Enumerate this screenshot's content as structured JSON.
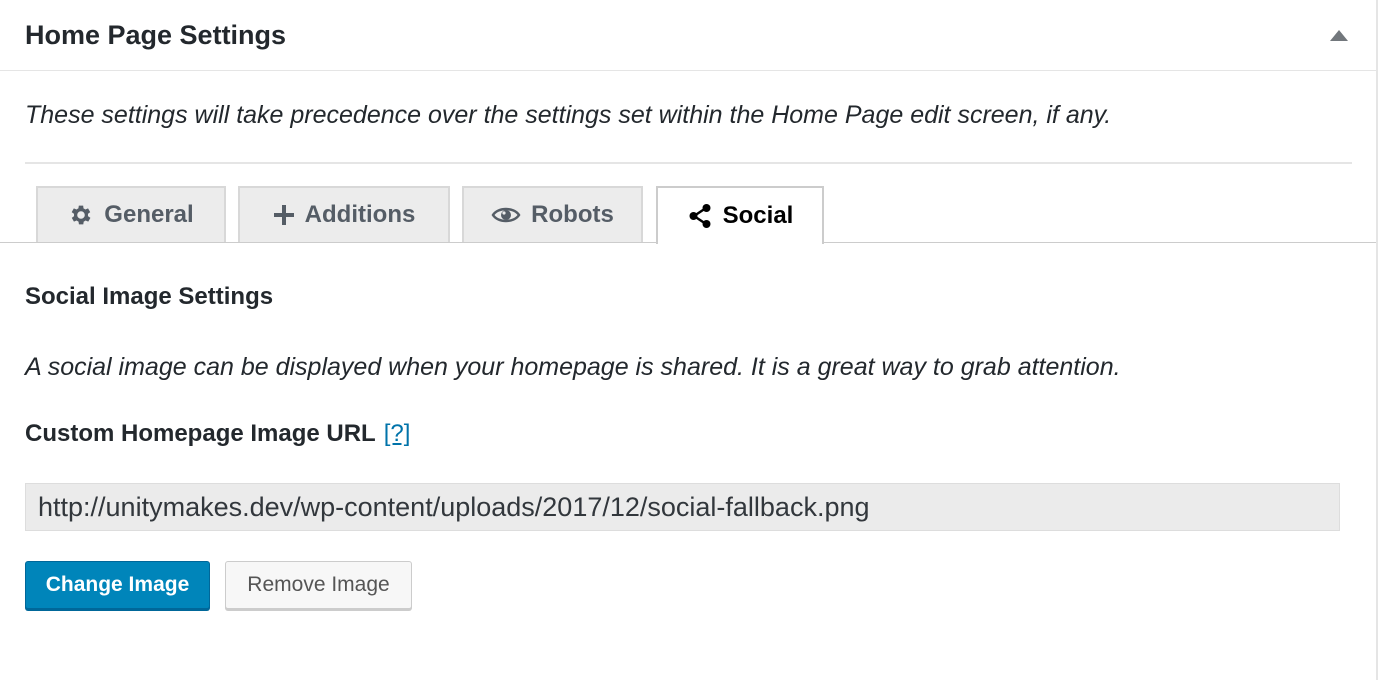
{
  "panel": {
    "title": "Home Page Settings",
    "toggle_icon": "triangle-up-icon",
    "description": "These settings will take precedence over the settings set within the Home Page edit screen, if any."
  },
  "tabs": [
    {
      "label": "General",
      "icon": "gear-icon",
      "active": false
    },
    {
      "label": "Additions",
      "icon": "plus-icon",
      "active": false
    },
    {
      "label": "Robots",
      "icon": "eye-icon",
      "active": false
    },
    {
      "label": "Social",
      "icon": "share-icon",
      "active": true
    }
  ],
  "social": {
    "section_title": "Social Image Settings",
    "section_description": "A social image can be displayed when your homepage is shared. It is a great way to grab attention.",
    "field_label": "Custom Homepage Image URL",
    "help_link": "[?]",
    "image_url": "http://unitymakes.dev/wp-content/uploads/2017/12/social-fallback.png",
    "change_button": "Change Image",
    "remove_button": "Remove Image"
  },
  "colors": {
    "primary_button": "#0085ba",
    "link": "#0073aa",
    "input_background": "#ebebeb"
  }
}
